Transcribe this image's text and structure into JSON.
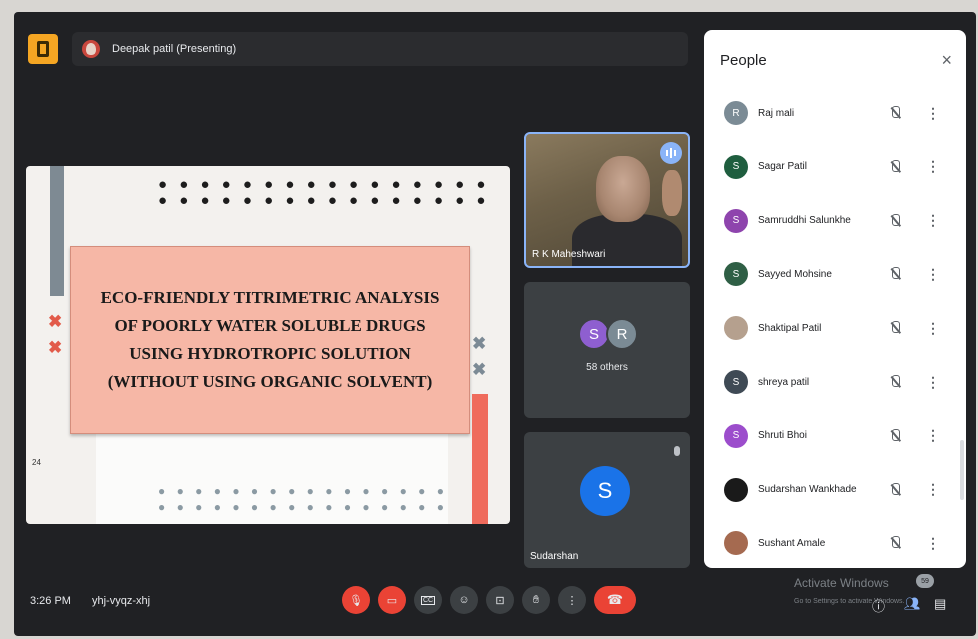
{
  "header": {
    "presenter": "Deepak patil (Presenting)"
  },
  "slide": {
    "title": "ECO-FRIENDLY TITRIMETRIC ANALYSIS\nOF POORLY WATER SOLUBLE DRUGS\nUSING HYDROTROPIC SOLUTION\n(WITHOUT USING ORGANIC SOLVENT)",
    "page_number": "24",
    "dot_rows": "● ● ● ● ● ● ● ● ● ● ● ● ● ● ● ●",
    "x_glyph": "✖"
  },
  "tiles": {
    "video_name": "R K Maheshwari",
    "others_initials": [
      "S",
      "R"
    ],
    "others_label": "58 others",
    "sudarshan_initial": "S",
    "sudarshan_name": "Sudarshan"
  },
  "people_panel": {
    "title": "People",
    "close_glyph": "×",
    "more_glyph": "⋮",
    "participants": [
      {
        "name": "Raj mali",
        "initial": "R",
        "color": "#7b8b95"
      },
      {
        "name": "Sagar Patil",
        "initial": "S",
        "color": "#1f5e3f"
      },
      {
        "name": "Samruddhi Salunkhe",
        "initial": "S",
        "color": "#8e44ad"
      },
      {
        "name": "Sayyed Mohsine",
        "initial": "S",
        "color": "#2f5f45"
      },
      {
        "name": "Shaktipal Patil",
        "initial": "",
        "color": "#b5a08e"
      },
      {
        "name": "shreya patil",
        "initial": "S",
        "color": "#3f4a55"
      },
      {
        "name": "Shruti Bhoi",
        "initial": "S",
        "color": "#9c4dcc"
      },
      {
        "name": "Sudarshan Wankhade",
        "initial": "",
        "color": "#1a1a1a"
      },
      {
        "name": "Sushant Amale",
        "initial": "",
        "color": "#a56a50"
      }
    ]
  },
  "bottom_bar": {
    "time": "3:26 PM",
    "meeting_code": "yhj-vyqz-xhj",
    "cc_label": "CC",
    "watermark_title": "Activate Windows",
    "watermark_sub": "Go to Settings to activate Windows.",
    "people_count": "59"
  },
  "colors": {
    "accent_blue": "#8ab4f8",
    "red": "#ea4335",
    "presenter_logo": "#f5a623"
  }
}
